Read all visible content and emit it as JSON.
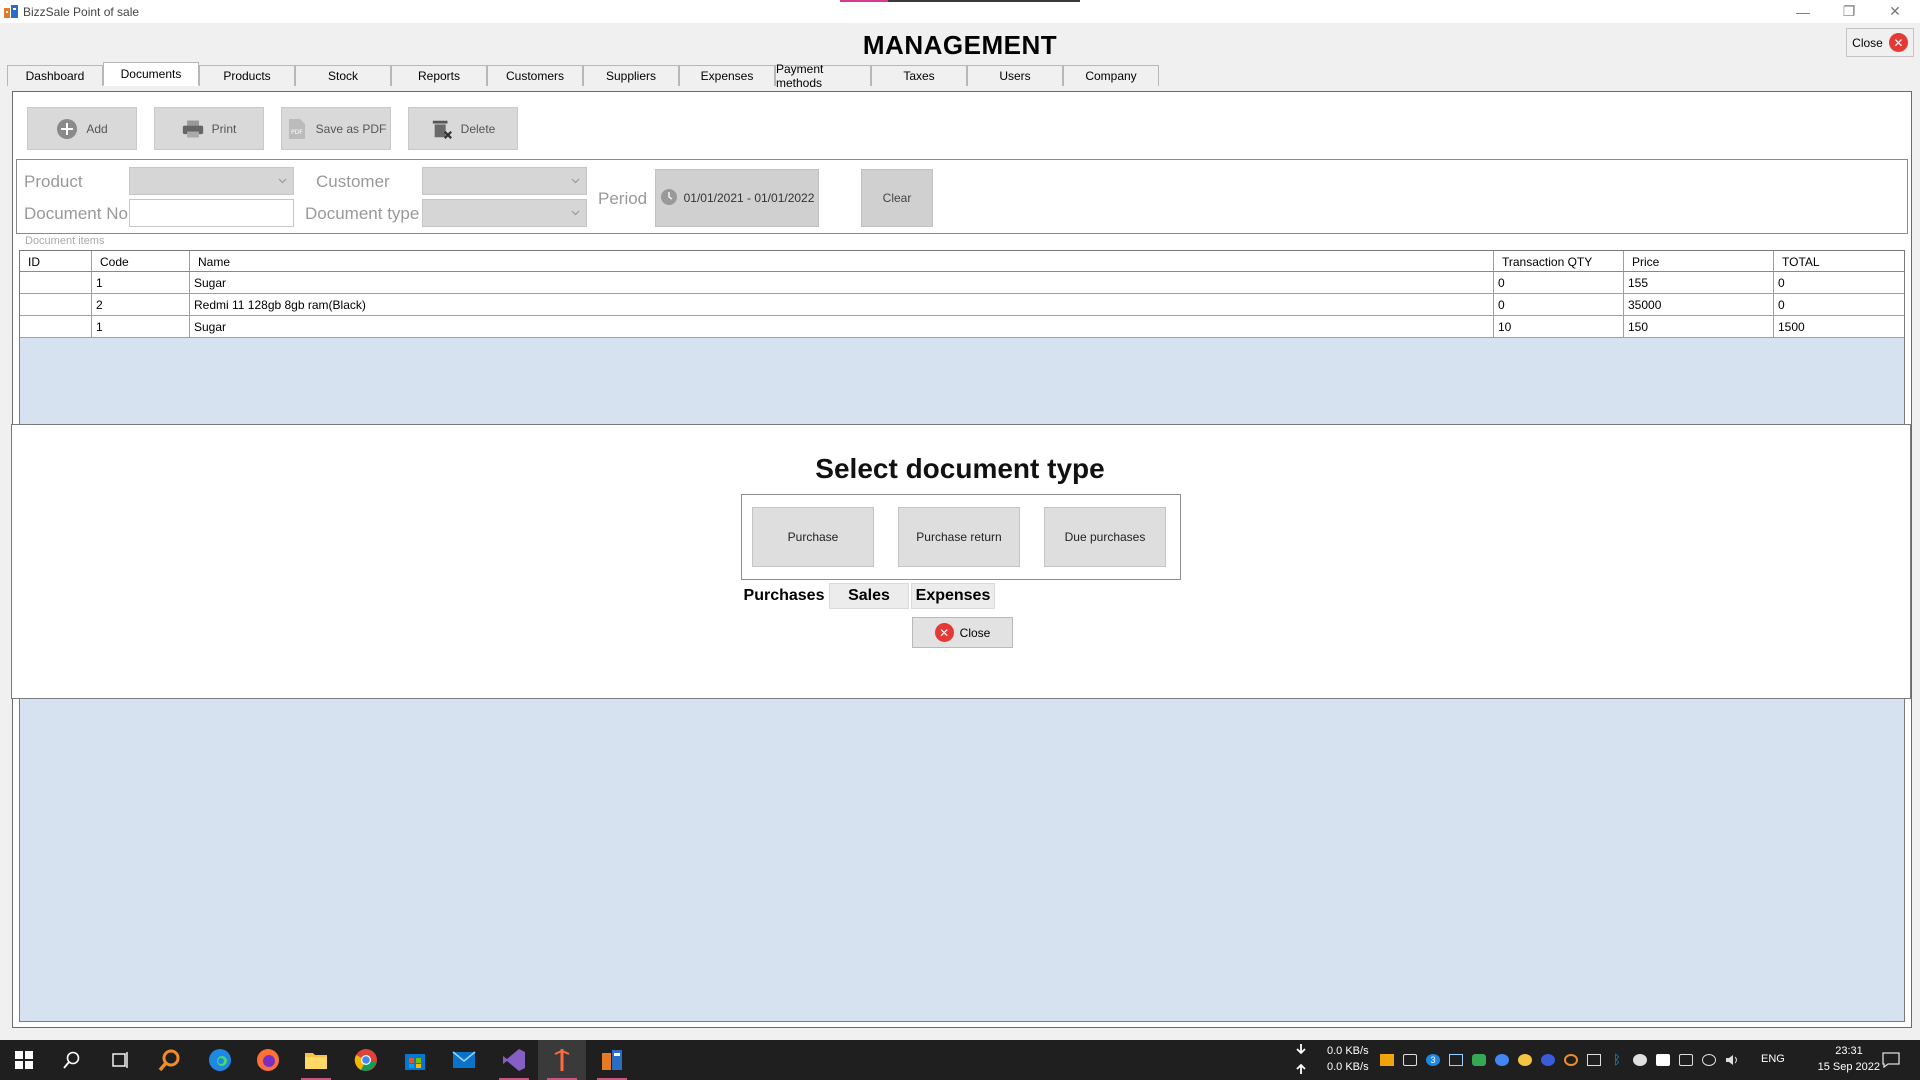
{
  "window": {
    "title": "BizzSale Point of sale",
    "controls": {
      "minimize": "—",
      "restore": "❐",
      "close": "✕"
    }
  },
  "header": {
    "title": "MANAGEMENT",
    "close_label": "Close"
  },
  "tabs": [
    {
      "label": "Dashboard"
    },
    {
      "label": "Documents",
      "active": true
    },
    {
      "label": "Products"
    },
    {
      "label": "Stock"
    },
    {
      "label": "Reports"
    },
    {
      "label": "Customers"
    },
    {
      "label": "Suppliers"
    },
    {
      "label": "Expenses"
    },
    {
      "label": "Payment methods"
    },
    {
      "label": "Taxes"
    },
    {
      "label": "Users"
    },
    {
      "label": "Company"
    }
  ],
  "toolbar": {
    "add_label": "Add",
    "print_label": "Print",
    "save_pdf_label": "Save as PDF",
    "delete_label": "Delete"
  },
  "filters": {
    "product_label": "Product",
    "product_value": "",
    "customer_label": "Customer",
    "customer_value": "",
    "document_no_label": "Document No",
    "document_no_value": "",
    "document_type_label": "Document type",
    "document_type_value": "",
    "period_label": "Period",
    "period_value": "01/01/2021 - 01/01/2022",
    "clear_label": "Clear"
  },
  "document_items": {
    "label": "Document items",
    "columns": [
      "ID",
      "Code",
      "Name",
      "Transaction QTY",
      "Price",
      "TOTAL"
    ],
    "rows": [
      {
        "id": "",
        "code": "1",
        "name": "Sugar",
        "qty": "0",
        "price": "155",
        "total": "0"
      },
      {
        "id": "",
        "code": "2",
        "name": "Redmi 11 128gb 8gb ram(Black)",
        "qty": "0",
        "price": "35000",
        "total": "0"
      },
      {
        "id": "",
        "code": "1",
        "name": "Sugar",
        "qty": "10",
        "price": "150",
        "total": "1500"
      }
    ]
  },
  "modal": {
    "title": "Select document type",
    "buttons": [
      "Purchase",
      "Purchase return",
      "Due purchases"
    ],
    "category_tabs": [
      {
        "label": "Purchases",
        "active": true
      },
      {
        "label": "Sales"
      },
      {
        "label": "Expenses"
      }
    ],
    "close_label": "Close"
  },
  "taskbar": {
    "net_down": "0.0 KB/s",
    "net_up": "0.0 KB/s",
    "language": "ENG",
    "time": "23:31",
    "date": "15 Sep 2022",
    "tray_badge": "3"
  },
  "colors": {
    "grid_background": "#d6e2ef",
    "close_red": "#e53935",
    "taskbar": "#1f1f1f"
  }
}
